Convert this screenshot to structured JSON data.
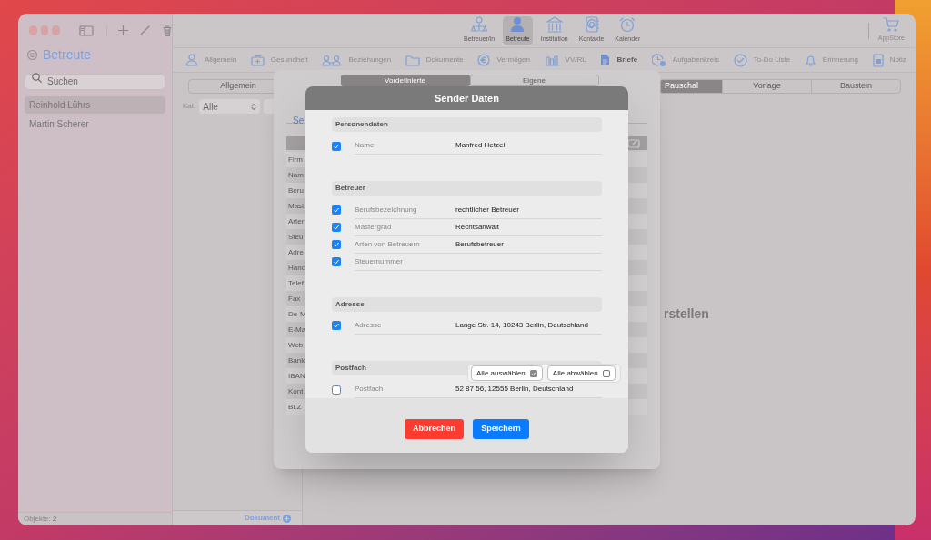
{
  "sidebar": {
    "title": "Betreute",
    "search_placeholder": "Suchen",
    "items": [
      {
        "label": "Reinhold Lührs",
        "selected": true
      },
      {
        "label": "Martin Scherer",
        "selected": false
      }
    ],
    "footer": "Objekte: **2**"
  },
  "toolbar": {
    "items": [
      {
        "label": "Betreuer/in",
        "selected": false
      },
      {
        "label": "Betreute",
        "selected": true
      },
      {
        "label": "Institution",
        "selected": false
      },
      {
        "label": "Kontakte",
        "selected": false
      },
      {
        "label": "Kalender",
        "selected": false
      }
    ],
    "store": "AppStore"
  },
  "nav": [
    {
      "label": "Allgemein",
      "selected": false
    },
    {
      "label": "Gesundheit",
      "selected": false
    },
    {
      "label": "Beziehungen",
      "selected": false
    },
    {
      "label": "Dokumente",
      "selected": false
    },
    {
      "label": "Vermögen",
      "selected": false
    },
    {
      "label": "VV/RL",
      "selected": false
    },
    {
      "label": "Briefe",
      "selected": true
    },
    {
      "label": "Aufgabenkreis",
      "selected": false
    },
    {
      "label": "To-Do Liste",
      "selected": false
    },
    {
      "label": "Erinnerung",
      "selected": false
    },
    {
      "label": "Notiz",
      "selected": false
    }
  ],
  "middle_column": {
    "segment": "Allgemein",
    "kat_label": "Kat:",
    "kat_value": "Alle",
    "footer_link": "Dokument"
  },
  "main": {
    "segments": [
      {
        "label": "Pauschal",
        "selected": true
      },
      {
        "label": "Vorlage",
        "selected": false
      },
      {
        "label": "Baustein",
        "selected": false
      }
    ],
    "placeholder": "rstellen"
  },
  "document_dialog": {
    "tabs": [
      {
        "label": "Vordefinierte",
        "selected": true
      },
      {
        "label": "Eigene",
        "selected": false
      }
    ],
    "link": "Se",
    "rows": [
      "Firm",
      "Nam",
      "Beru",
      "Mast",
      "Arter",
      "Steu",
      "Adre",
      "Hand",
      "Telef",
      "Fax",
      "De-M",
      "E-Ma",
      "Web",
      "Bank",
      "IBAN",
      "Kont",
      "BLZ"
    ]
  },
  "sender_dialog": {
    "title": "Sender Daten",
    "sections": [
      {
        "title": "Personendaten",
        "rows": [
          {
            "label": "Name",
            "value": "Manfred Hetzel",
            "checked": true
          }
        ]
      },
      {
        "title": "Betreuer",
        "rows": [
          {
            "label": "Berufsbezeichnung",
            "value": "rechtlicher Betreuer",
            "checked": true
          },
          {
            "label": "Mastergrad",
            "value": "Rechtsanwalt",
            "checked": true
          },
          {
            "label": "Arten von Betreuern",
            "value": "Berufsbetreuer",
            "checked": true
          },
          {
            "label": "Steuernummer",
            "checked": true
          }
        ]
      },
      {
        "title": "Adresse",
        "rows": [
          {
            "label": "Adresse",
            "value": "Lange Str. 14, 10243 Berlin, Deutschland",
            "checked": true
          }
        ]
      },
      {
        "title": "Postfach",
        "rows": [
          {
            "label": "Postfach",
            "value": "52 87 56, 12555 Berlin, Deutschland",
            "checked": false
          }
        ]
      }
    ],
    "popover": [
      {
        "label": "Alle auswählen",
        "checked": true
      },
      {
        "label": "Alle abwählen",
        "checked": false
      }
    ],
    "buttons": [
      {
        "label": "Abbrechen",
        "kind": "cancel"
      },
      {
        "label": "Speichern",
        "kind": "primary"
      }
    ]
  }
}
